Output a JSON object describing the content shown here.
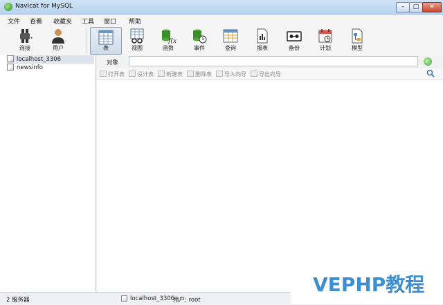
{
  "window": {
    "title": "Navicat for MySQL"
  },
  "menu": [
    "文件",
    "查看",
    "收藏夹",
    "工具",
    "窗口",
    "帮助"
  ],
  "toolbar": {
    "connect": "连接",
    "user": "用户",
    "table": "表",
    "view": "视图",
    "function": "函数",
    "event": "事件",
    "query": "查询",
    "report": "报表",
    "backup": "备份",
    "schedule": "计划",
    "model": "模型"
  },
  "connections": [
    "localhost_3306",
    "newsinfo"
  ],
  "objects": {
    "tab": "对象",
    "search_value": ""
  },
  "actions": [
    "打开表",
    "设计表",
    "新建表",
    "删除表",
    "导入向导",
    "导出向导"
  ],
  "status": {
    "count": "2 服务器",
    "connection": "localhost_3306",
    "user": "用户: root"
  },
  "watermark": "VEPHP教程",
  "colors": {
    "accent": "#3e8fd1",
    "selection": "#dde3ea"
  }
}
